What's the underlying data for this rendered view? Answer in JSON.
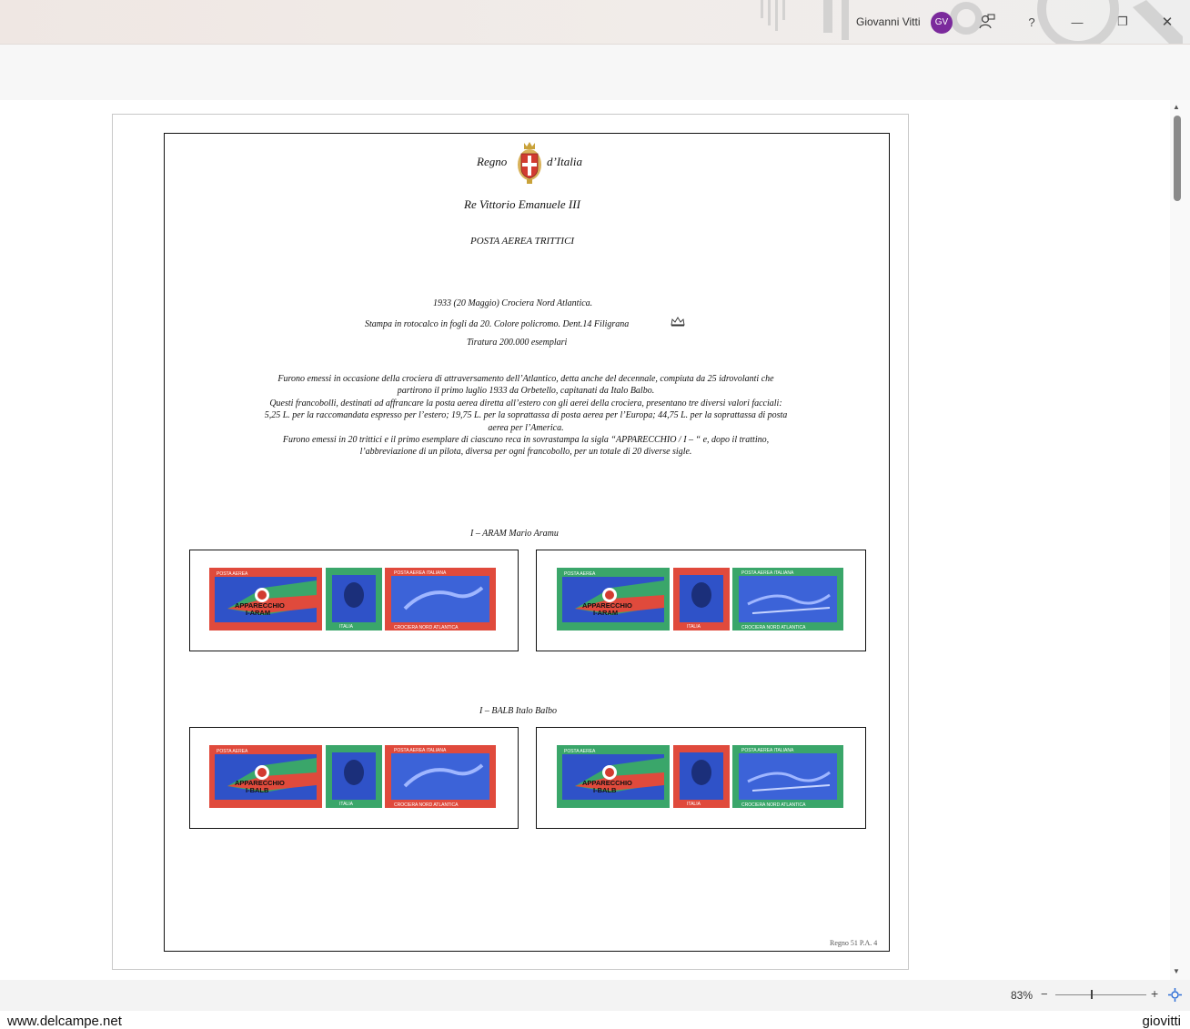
{
  "titlebar": {
    "user_name": "Giovanni Vitti",
    "avatar_initials": "GV",
    "help": "?",
    "minimize": "—",
    "restore": "❐",
    "close": "✕"
  },
  "page": {
    "heading_left": "Regno",
    "heading_right": "d’Italia",
    "king": "Re Vittorio Emanuele III",
    "section": "POSTA AEREA  TRITTICI",
    "issue_line1": "1933 (20 Maggio) Crociera Nord Atlantica.",
    "issue_line2": "Stampa in rotocalco in fogli da 20. Colore policromo. Dent.14 Filigrana",
    "issue_line3": "Tiratura 200.000 esemplari",
    "desc_lines": [
      "Furono emessi in occasione della crociera di attraversamento dell’Atlantico, detta anche del decennale, compiuta da 25 idrovolanti che",
      "partirono il primo luglio 1933 da Orbetello, capitanati da Italo Balbo.",
      "Questi francobolli, destinati ad affrancare la posta aerea diretta all’estero con gli aerei della crociera, presentano tre diversi valori facciali:",
      "5,25 L. per la raccomandata espresso per l’estero; 19,75 L. per la soprattassa di posta aerea per l’Europa; 44,75 L. per la soprattassa di posta",
      "aerea per l’America.",
      "Furono emessi in 20 trittici e il primo esemplare di ciascuno reca in sovrastampa la sigla “APPARECCHIO / I – “ e, dopo il trattino,",
      "l’abbreviazione di un pilota, diversa per ogni francobollo, per un totale di 20 diverse sigle."
    ],
    "groups": [
      {
        "caption": "I – ARAM    Mario Aramu",
        "overprint": "I-ARAM"
      },
      {
        "caption": "I – BALB   Italo Balbo",
        "overprint": "I-BALB"
      }
    ],
    "stamp_texts": {
      "overprint_word": "APPARECCHIO",
      "posta_aerea": "POSTA AEREA",
      "posta_aerea_italiana": "POSTA AEREA ITALIANA",
      "italia": "ITALIA",
      "crociera": "CROCIERA NORD ATLANTICA"
    },
    "footer_ref": "Regno 51 P.A. 4"
  },
  "statusbar": {
    "zoom": "83%",
    "zoom_minus": "−",
    "zoom_plus": "+"
  },
  "watermark": {
    "left": "www.delcampe.net",
    "right": "giovitti"
  },
  "colors": {
    "stamp_red": "#e04a3c",
    "stamp_green": "#3aa66a",
    "stamp_blue": "#2f52c8",
    "avatar": "#7b2a9c"
  }
}
